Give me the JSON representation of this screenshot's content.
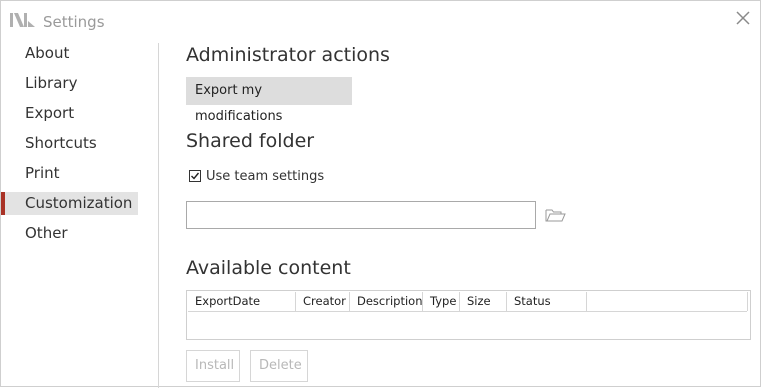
{
  "window": {
    "title": "Settings"
  },
  "sidebar": {
    "items": [
      {
        "label": "About"
      },
      {
        "label": "Library"
      },
      {
        "label": "Export"
      },
      {
        "label": "Shortcuts"
      },
      {
        "label": "Print"
      },
      {
        "label": "Customization",
        "active": true
      },
      {
        "label": "Other"
      }
    ]
  },
  "admin": {
    "title": "Administrator actions",
    "export_label": "Export my modifications"
  },
  "shared": {
    "title": "Shared folder",
    "checkbox_label": "Use team settings",
    "checkbox_checked": true,
    "path_value": ""
  },
  "available": {
    "title": "Available content",
    "columns": [
      "ExportDate",
      "Creator",
      "Description",
      "Type",
      "Size",
      "Status"
    ],
    "rows": []
  },
  "actions": {
    "install_label": "Install",
    "delete_label": "Delete"
  },
  "colors": {
    "accent": "#a93226",
    "active_bg": "#e3e3e3",
    "button_bg": "#dddddd"
  }
}
